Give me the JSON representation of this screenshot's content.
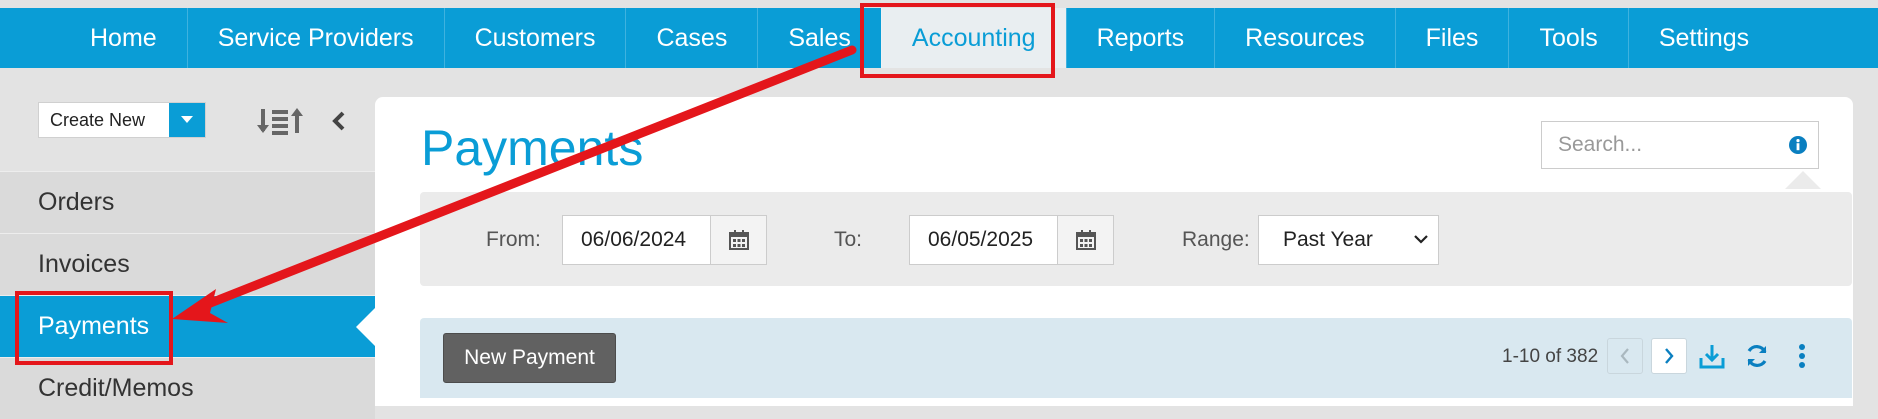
{
  "nav": {
    "items": [
      "Home",
      "Service Providers",
      "Customers",
      "Cases",
      "Sales",
      "Accounting",
      "Reports",
      "Resources",
      "Files",
      "Tools",
      "Settings"
    ],
    "active": "Accounting"
  },
  "sidebar": {
    "create_new": "Create New",
    "items": [
      {
        "label": "Orders"
      },
      {
        "label": "Invoices"
      },
      {
        "label": "Payments",
        "active": true
      },
      {
        "label": "Credit/Memos"
      }
    ],
    "icons": [
      "caret-down-icon",
      "sort-icon",
      "collapse-left-icon"
    ]
  },
  "main": {
    "title": "Payments",
    "search": {
      "placeholder": "Search...",
      "icon": "info-icon"
    }
  },
  "filters": {
    "from_label": "From:",
    "from_value": "06/06/2024",
    "to_label": "To:",
    "to_value": "06/05/2025",
    "range_label": "Range:",
    "range_value": "Past Year"
  },
  "toolbar": {
    "new_button": "New Payment",
    "pager": "1-10 of 382"
  },
  "colors": {
    "brand": "#0a9dd6",
    "highlight": "#e4161b"
  }
}
